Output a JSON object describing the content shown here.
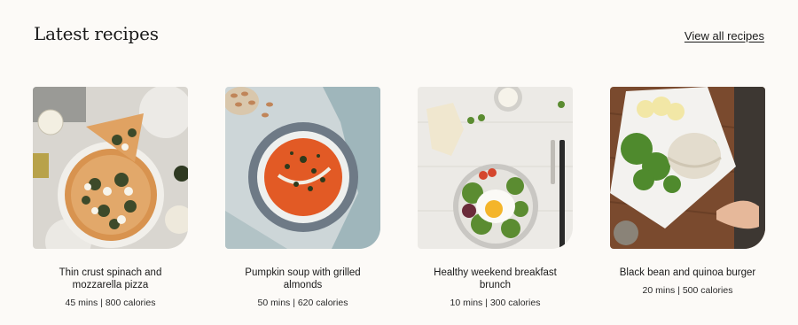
{
  "section": {
    "title": "Latest recipes",
    "view_all_label": "View all recipes"
  },
  "recipes": [
    {
      "title": "Thin crust spinach and mozzarella pizza",
      "meta": "45 mins | 800 calories"
    },
    {
      "title": "Pumpkin soup with grilled almonds",
      "meta": "50 mins | 620 calories"
    },
    {
      "title": "Healthy weekend breakfast brunch",
      "meta": "10 mins | 300 calories"
    },
    {
      "title": "Black bean and quinoa burger",
      "meta": "20 mins | 500 calories"
    }
  ]
}
